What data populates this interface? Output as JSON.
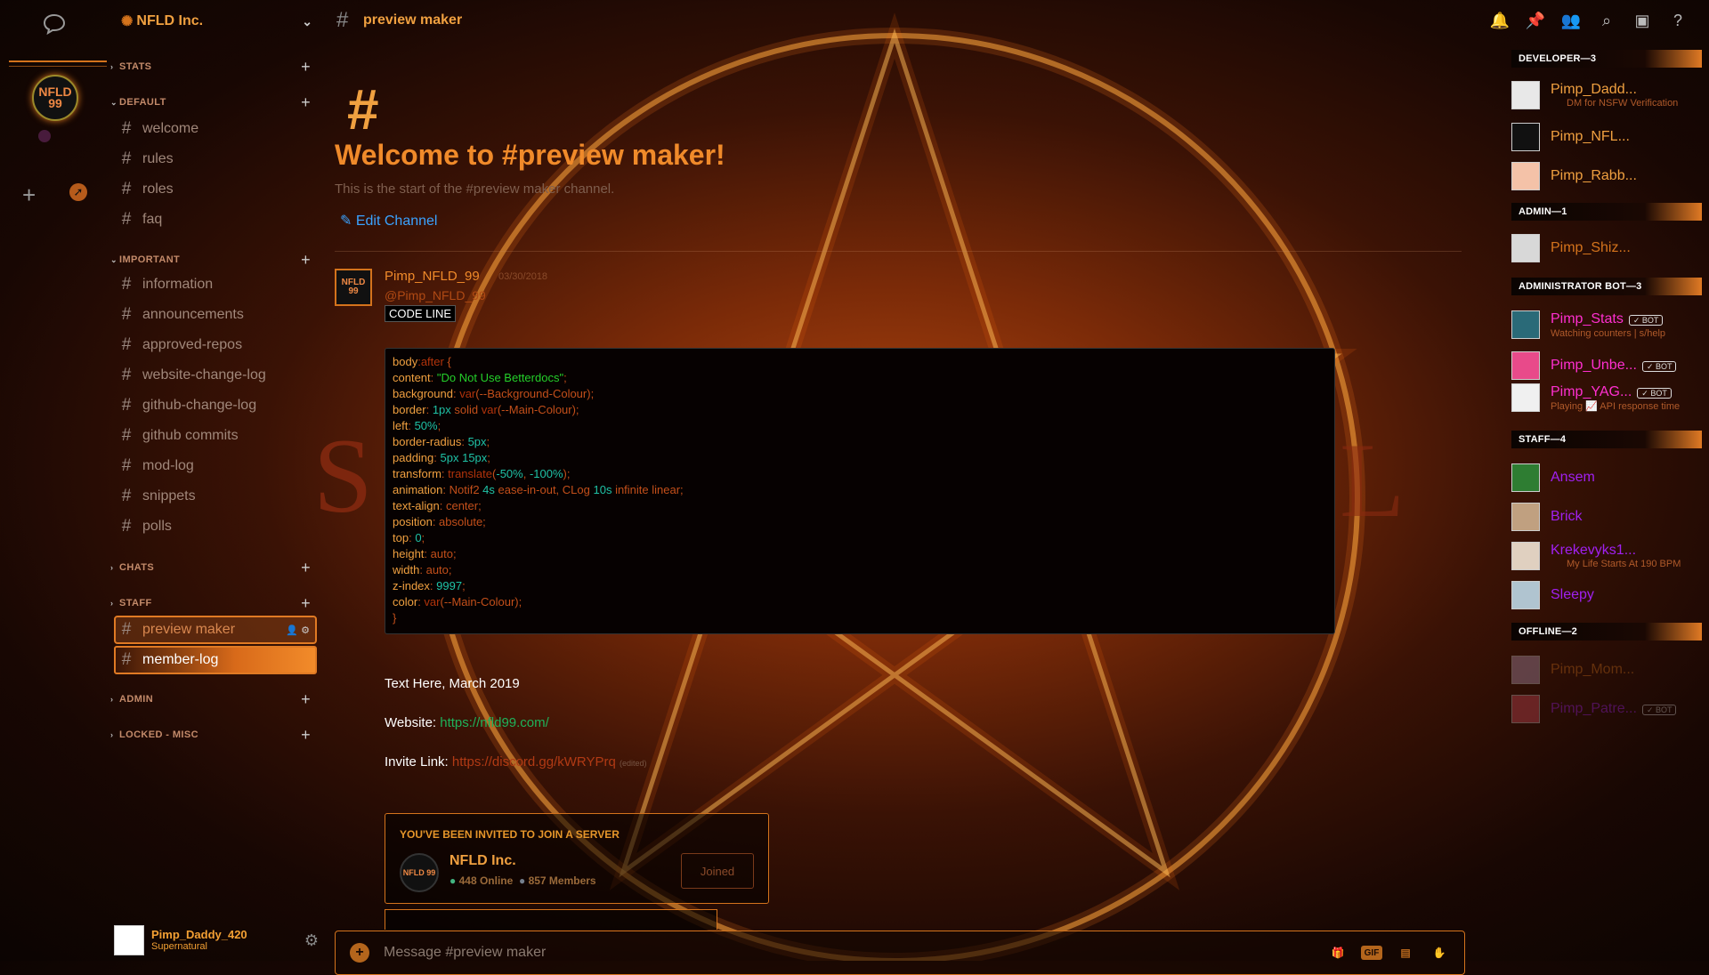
{
  "rail": {
    "server_initials": "NFLD 99"
  },
  "sidebar": {
    "server_name": "NFLD Inc.",
    "categories": [
      {
        "label": "STATS"
      },
      {
        "label": "DEFAULT"
      },
      {
        "label": "IMPORTANT"
      },
      {
        "label": "CHATS"
      },
      {
        "label": "STAFF"
      },
      {
        "label": "ADMIN"
      },
      {
        "label": "LOCKED - MISC"
      }
    ],
    "channels": [
      {
        "label": "welcome"
      },
      {
        "label": "rules"
      },
      {
        "label": "roles"
      },
      {
        "label": "faq"
      },
      {
        "label": "information"
      },
      {
        "label": "announcements"
      },
      {
        "label": "approved-repos"
      },
      {
        "label": "website-change-log"
      },
      {
        "label": "github-change-log"
      },
      {
        "label": "github commits"
      },
      {
        "label": "mod-log"
      },
      {
        "label": "snippets"
      },
      {
        "label": "polls"
      },
      {
        "label": "preview maker"
      },
      {
        "label": "member-log"
      }
    ],
    "user": {
      "name": "Pimp_Daddy_420",
      "status": "Supernatural"
    }
  },
  "topbar": {
    "channel": "preview maker"
  },
  "main": {
    "welcome_title": "Welcome to #preview maker!",
    "welcome_sub": "This is the start of the #preview maker channel.",
    "edit_channel": "Edit Channel",
    "message": {
      "author": "Pimp_NFLD_99",
      "timestamp": "03/30/2018",
      "mention": "@Pimp_NFLD_99",
      "code_line": "CODE LINE",
      "avatar_text": "NFLD 99"
    },
    "code": [
      "body:after {",
      "content: \"Do Not Use Betterdocs\";",
      "background: var(--Background-Colour);",
      "border: 1px solid var(--Main-Colour);",
      "left: 50%;",
      "border-radius: 5px;",
      "padding: 5px 15px;",
      "transform: translate(-50%, -100%);",
      "animation: Notif2 4s ease-in-out, CLog 10s infinite linear;",
      "text-align: center;",
      "position: absolute;",
      "top: 0;",
      "height: auto;",
      "width: auto;",
      "z-index: 9997;",
      "color: var(--Main-Colour);",
      "}"
    ],
    "text_here": "Text Here, March 2019",
    "website_label": "Website: ",
    "website_url": "https://nfld99.com/",
    "invite_label": "Invite Link: ",
    "invite_url": "https://discord.gg/kWRYPrq",
    "edited": "(edited)",
    "invite": {
      "header": "YOU'VE BEEN INVITED TO JOIN A SERVER",
      "server_name": "NFLD Inc.",
      "online": "448 Online",
      "members": "857 Members",
      "button": "Joined"
    },
    "input_placeholder": "Message #preview maker",
    "gif_label": "GIF"
  },
  "members": {
    "categories": [
      "DEVELOPER—3",
      "ADMIN—1",
      "ADMINISTRATOR BOT—3",
      "STAFF—4",
      "OFFLINE—2"
    ],
    "list": [
      {
        "name": "Pimp_Dadd...",
        "sub": "DM for NSFW Verification",
        "color": "#f0a040"
      },
      {
        "name": "Pimp_NFL...",
        "sub": "",
        "color": "#f0a040"
      },
      {
        "name": "Pimp_Rabb...",
        "sub": "",
        "color": "#f0a040"
      },
      {
        "name": "Pimp_Shiz...",
        "sub": "",
        "color": "#d4731c"
      },
      {
        "name": "Pimp_Stats",
        "sub": "Watching counters | s/help",
        "color": "#ff2fd0",
        "bot": "✓ BOT"
      },
      {
        "name": "Pimp_Unbe...",
        "sub": "",
        "color": "#ff2fd0",
        "bot": "✓ BOT"
      },
      {
        "name": "Pimp_YAG...",
        "sub": "Playing 📈 API response time",
        "color": "#ff2fd0",
        "bot": "✓ BOT"
      },
      {
        "name": "Ansem",
        "sub": "",
        "color": "#a020f0"
      },
      {
        "name": "Brick",
        "sub": "",
        "color": "#a020f0"
      },
      {
        "name": "Krekevyks1...",
        "sub": "My Life Starts At 190 BPM",
        "color": "#a020f0"
      },
      {
        "name": "Sleepy",
        "sub": "",
        "color": "#a020f0"
      },
      {
        "name": "Pimp_Mom...",
        "sub": "",
        "color": "#d4731c"
      },
      {
        "name": "Pimp_Patre...",
        "sub": "",
        "color": "#a020f0",
        "bot": "✓ BOT"
      }
    ]
  },
  "colors": {
    "accent": "#e07a24",
    "link": "#3aa3ff",
    "bg": "#180703"
  }
}
